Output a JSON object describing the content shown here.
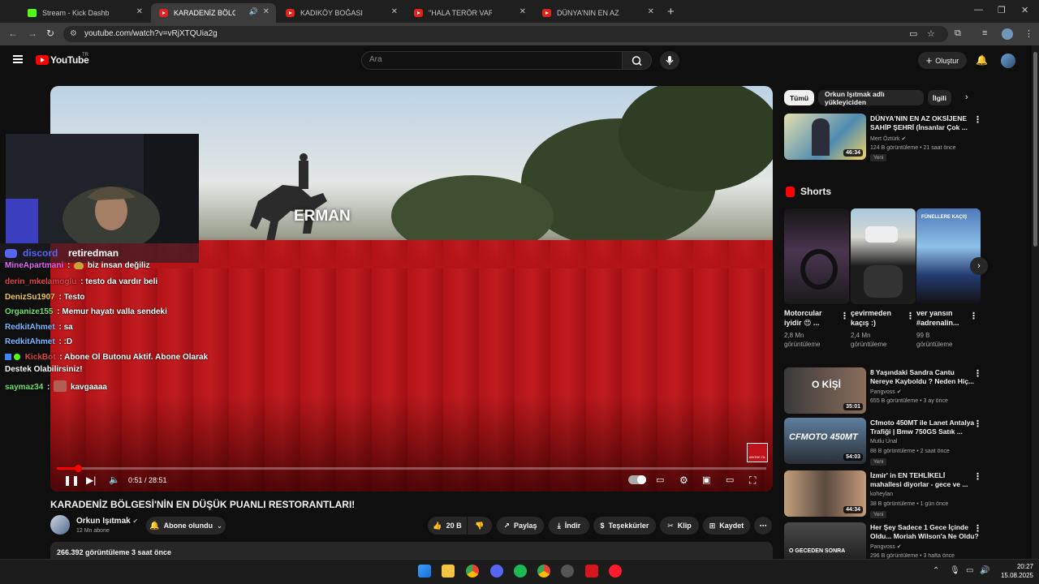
{
  "browser": {
    "tabs": [
      {
        "title": "Stream - Kick Dashboard",
        "type": "kick"
      },
      {
        "title": "KARADENİZ BÖLGESİ'NİN E",
        "type": "youtube",
        "active": true
      },
      {
        "title": "KADIKÖY BOĞASI ASLAN İLE Y",
        "type": "youtube"
      },
      {
        "title": "\"HALA TERÖR VAR MI BURALA",
        "type": "youtube"
      },
      {
        "title": "DÜNYA'NIN EN AZ OKSİJENE S",
        "type": "youtube"
      }
    ],
    "url": "youtube.com/watch?v=vRjXTQUia2g"
  },
  "youtube": {
    "logo_text": "YouTube",
    "country_code": "TR",
    "search_placeholder": "Ara",
    "create_label": "Oluştur"
  },
  "video": {
    "overlay_text": "ERMAN",
    "time": "0:51 / 28:51",
    "progress": 0.0297,
    "badge_text": "ABONE OL",
    "title": "KARADENİZ BÖLGESİ'NİN EN DÜŞÜK PUANLI RESTORANTLARI!",
    "channel": "Orkun Işıtmak",
    "subscribers": "12 Mn abone",
    "subscribe_label": "Abone olundu",
    "likes": "20 B",
    "share_label": "Paylaş",
    "download_label": "İndir",
    "thanks_label": "Teşekkürler",
    "clip_label": "Klip",
    "save_label": "Kaydet",
    "views_time": "266.392 görüntüleme  3 saat önce"
  },
  "stream_overlay": {
    "discord_label": "discord",
    "discord_user": "retiredman",
    "chat": [
      {
        "user": "MineApartmani",
        "msg": "biz insan değiliz",
        "color": "#e36cf2"
      },
      {
        "user": "derin_mkelamoglu",
        "msg": "testo da vardır beli",
        "color": "#e0454a"
      },
      {
        "user": "DenizSu1907",
        "msg": "Testo",
        "color": "#f2c94c"
      },
      {
        "user": "Organize155",
        "msg": "Memur hayatı valla sendeki",
        "color": "#6ee06e"
      },
      {
        "user": "RedkitAhmet",
        "msg": "sa",
        "color": "#7eb7ff"
      },
      {
        "user": "RedkitAhmet",
        "msg": ":D",
        "color": "#7eb7ff"
      },
      {
        "user": "KickBot",
        "msg": "Abone Ol Butonu Aktif. Abone Olarak",
        "color": "#e0454a"
      },
      {
        "user": "",
        "msg": "Destek Olabilirsiniz!",
        "color": "#ffffff"
      },
      {
        "user": "saymaz34",
        "msg": "kavgaaaa",
        "color": "#6ee06e"
      }
    ]
  },
  "sidebar": {
    "chips": [
      "Tümü",
      "Orkun Işıtmak adlı yükleyiciden",
      "İlgili"
    ],
    "top_rec": {
      "title_l1": "DÜNYA'NIN EN AZ OKSİJENE",
      "title_l2": "SAHİP ŞEHRİ (İnsanlar Çok ...",
      "channel": "Mert Öztürk",
      "meta": "124 B görüntüleme • 21 saat önce",
      "badge": "Yeni",
      "duration": "46:34"
    },
    "shorts_title": "Shorts",
    "shorts": [
      {
        "title_l1": "Motorcular",
        "title_l2": "iyidir 😍 ...",
        "views_l1": "2,8 Mn",
        "views_l2": "görüntüleme"
      },
      {
        "title_l1": "çevirmeden",
        "title_l2": "kaçış :)",
        "views_l1": "2,4 Mn",
        "views_l2": "görüntüleme"
      },
      {
        "title_l1": "ver yansın",
        "title_l2": "#adrenalin...",
        "views_l1": "99 B",
        "views_l2": "görüntüleme"
      }
    ],
    "short3_overlay": "FÜNELLERE KAÇIŞ",
    "videos": [
      {
        "title_l1": "8 Yaşındaki Sandra Cantu",
        "title_l2": "Nereye Kayboldu ? Neden Hiç...",
        "channel": "Pangvoss",
        "meta": "655 B görüntüleme • 3 ay önce",
        "badge": "",
        "duration": "35:01",
        "overlay": "O KİŞİ"
      },
      {
        "title_l1": "Cfmoto 450MT ile Lanet Antalya",
        "title_l2": "Trafiği | Bmw 750GS Satık ...",
        "channel": "Mutlu Ünal",
        "meta": "88 B görüntüleme • 2 saat önce",
        "badge": "Yeni",
        "duration": "54:03",
        "overlay": "CFMOTO 450MT"
      },
      {
        "title_l1": "İzmir' in EN TEHLİKELİ",
        "title_l2": "mahallesi diyorlar -  gece ve ...",
        "channel": "koheylan",
        "meta": "38 B görüntüleme • 1 gün önce",
        "badge": "Yeni",
        "duration": "44:34",
        "overlay": ""
      },
      {
        "title_l1": "Her Şey Sadece 1 Gece İçinde",
        "title_l2": "Oldu... Moriah Wilson'a Ne Oldu?",
        "channel": "Pangvoss",
        "meta": "296 B görüntüleme • 3 hafta önce",
        "badge": "",
        "duration": "",
        "overlay": "O GECEDEN SONRA"
      }
    ]
  },
  "taskbar": {
    "time": "20:27",
    "date": "15.08.2025"
  }
}
